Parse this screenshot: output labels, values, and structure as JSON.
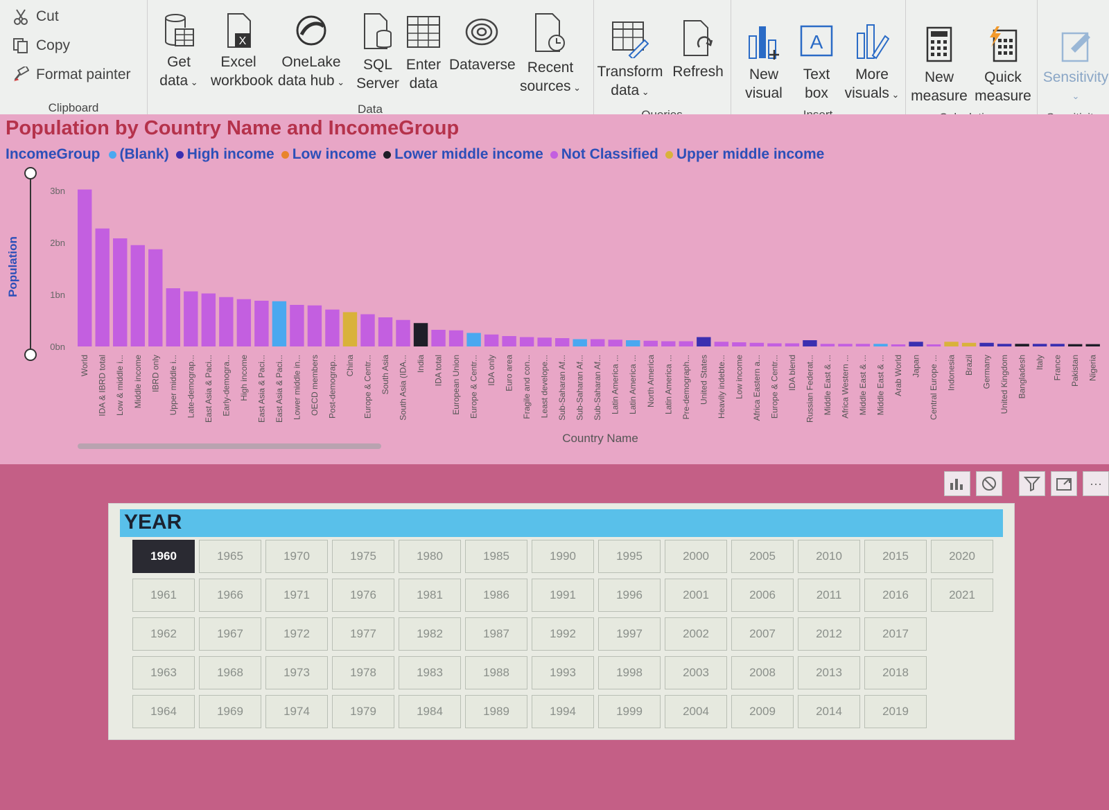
{
  "ribbon": {
    "clipboard": {
      "label": "Clipboard",
      "cut": "Cut",
      "copy": "Copy",
      "format_painter": "Format painter"
    },
    "data": {
      "label": "Data",
      "get_data": [
        "Get",
        "data"
      ],
      "excel": [
        "Excel",
        "workbook"
      ],
      "onelake": [
        "OneLake",
        "data hub"
      ],
      "sql": [
        "SQL",
        "Server"
      ],
      "enter": [
        "Enter",
        "data"
      ],
      "dataverse": "Dataverse",
      "recent": [
        "Recent",
        "sources"
      ]
    },
    "queries": {
      "label": "Queries",
      "transform": [
        "Transform",
        "data"
      ],
      "refresh": "Refresh"
    },
    "insert": {
      "label": "Insert",
      "new_visual": [
        "New",
        "visual"
      ],
      "text_box": [
        "Text",
        "box"
      ],
      "more_visuals": [
        "More",
        "visuals"
      ]
    },
    "calculations": {
      "label": "Calculations",
      "new_measure": [
        "New",
        "measure"
      ],
      "quick_measure": [
        "Quick",
        "measure"
      ]
    },
    "sensitivity": {
      "label": "Sensitivity",
      "button": "Sensitivity"
    }
  },
  "chart_data": {
    "type": "bar",
    "title": "Population by Country Name and IncomeGroup",
    "xlabel": "Country Name",
    "ylabel": "Population",
    "ylim": [
      0,
      3000000000
    ],
    "yticks": [
      "0bn",
      "1bn",
      "2bn",
      "3bn"
    ],
    "legend_title": "IncomeGroup",
    "legend": [
      {
        "name": "(Blank)",
        "color": "#4aa8f0"
      },
      {
        "name": "High income",
        "color": "#3b2fb0"
      },
      {
        "name": "Low income",
        "color": "#e8842c"
      },
      {
        "name": "Lower middle income",
        "color": "#1e1e28"
      },
      {
        "name": "Not Classified",
        "color": "#c35fe0"
      },
      {
        "name": "Upper middle income",
        "color": "#d9b23b"
      }
    ],
    "categories": [
      "World",
      "IDA & IBRD total",
      "Low & middle i...",
      "Middle income",
      "IBRD only",
      "Upper middle i...",
      "Late-demograp...",
      "East Asia & Paci...",
      "Early-demogra...",
      "High income",
      "East Asia & Paci...",
      "East Asia & Paci...",
      "Lower middle in...",
      "OECD members",
      "Post-demograp...",
      "China",
      "Europe & Centr...",
      "South Asia",
      "South Asia (IDA...",
      "India",
      "IDA total",
      "European Union",
      "Europe & Centr...",
      "IDA only",
      "Euro area",
      "Fragile and con...",
      "Least develope...",
      "Sub-Saharan Af...",
      "Sub-Saharan Af...",
      "Sub-Saharan Af...",
      "Latin America ...",
      "Latin America ...",
      "North America",
      "Latin America ...",
      "Pre-demograph...",
      "United States",
      "Heavily indebte...",
      "Low income",
      "Africa Eastern a...",
      "Europe & Centr...",
      "IDA blend",
      "Russian Federat...",
      "Middle East & ...",
      "Africa Western ...",
      "Middle East & ...",
      "Middle East & ...",
      "Arab World",
      "Japan",
      "Central Europe ...",
      "Indonesia",
      "Brazil",
      "Germany",
      "United Kingdom",
      "Bangladesh",
      "Italy",
      "France",
      "Pakistan",
      "Nigeria"
    ],
    "values": [
      3.02,
      2.27,
      2.08,
      1.95,
      1.87,
      1.12,
      1.06,
      1.02,
      0.95,
      0.91,
      0.88,
      0.87,
      0.8,
      0.79,
      0.71,
      0.66,
      0.62,
      0.56,
      0.51,
      0.45,
      0.32,
      0.31,
      0.26,
      0.23,
      0.2,
      0.18,
      0.17,
      0.16,
      0.14,
      0.14,
      0.13,
      0.12,
      0.11,
      0.1,
      0.1,
      0.18,
      0.09,
      0.08,
      0.07,
      0.06,
      0.06,
      0.12,
      0.05,
      0.05,
      0.05,
      0.05,
      0.04,
      0.09,
      0.04,
      0.09,
      0.07,
      0.07,
      0.05,
      0.05,
      0.05,
      0.05,
      0.045,
      0.045
    ],
    "groups": [
      "Not Classified",
      "Not Classified",
      "Not Classified",
      "Not Classified",
      "Not Classified",
      "Not Classified",
      "Not Classified",
      "Not Classified",
      "Not Classified",
      "Not Classified",
      "Not Classified",
      "(Blank)",
      "Not Classified",
      "Not Classified",
      "Not Classified",
      "Upper middle income",
      "Not Classified",
      "Not Classified",
      "Not Classified",
      "Lower middle income",
      "Not Classified",
      "Not Classified",
      "(Blank)",
      "Not Classified",
      "Not Classified",
      "Not Classified",
      "Not Classified",
      "Not Classified",
      "(Blank)",
      "Not Classified",
      "Not Classified",
      "(Blank)",
      "Not Classified",
      "Not Classified",
      "Not Classified",
      "High income",
      "Not Classified",
      "Not Classified",
      "Not Classified",
      "Not Classified",
      "Not Classified",
      "High income",
      "Not Classified",
      "Not Classified",
      "Not Classified",
      "(Blank)",
      "Not Classified",
      "High income",
      "Not Classified",
      "Upper middle income",
      "Upper middle income",
      "High income",
      "High income",
      "Lower middle income",
      "High income",
      "High income",
      "Lower middle income",
      "Lower middle income"
    ]
  },
  "slicer": {
    "title": "YEAR",
    "selected": "1960",
    "columns": [
      [
        "1960",
        "1961",
        "1962",
        "1963",
        "1964"
      ],
      [
        "1965",
        "1966",
        "1967",
        "1968",
        "1969"
      ],
      [
        "1970",
        "1971",
        "1972",
        "1973",
        "1974"
      ],
      [
        "1975",
        "1976",
        "1977",
        "1978",
        "1979"
      ],
      [
        "1980",
        "1981",
        "1982",
        "1983",
        "1984"
      ],
      [
        "1985",
        "1986",
        "1987",
        "1988",
        "1989"
      ],
      [
        "1990",
        "1991",
        "1992",
        "1993",
        "1994"
      ],
      [
        "1995",
        "1996",
        "1997",
        "1998",
        "1999"
      ],
      [
        "2000",
        "2001",
        "2002",
        "2003",
        "2004"
      ],
      [
        "2005",
        "2006",
        "2007",
        "2008",
        "2009"
      ],
      [
        "2010",
        "2011",
        "2012",
        "2013",
        "2014"
      ],
      [
        "2015",
        "2016",
        "2017",
        "2018",
        "2019"
      ],
      [
        "2020",
        "2021"
      ]
    ]
  },
  "visual_header": {
    "more_options": "···"
  }
}
